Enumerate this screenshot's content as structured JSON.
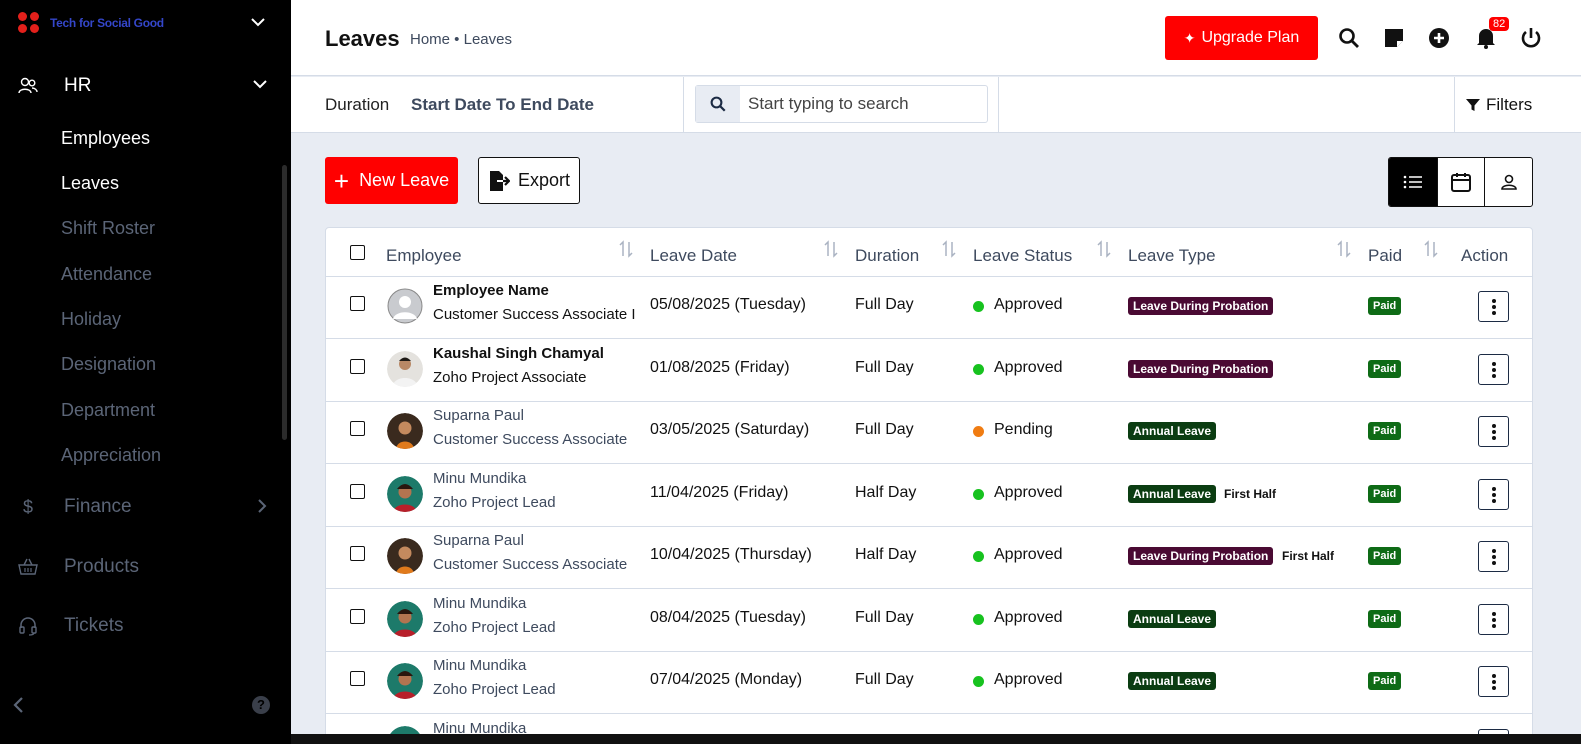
{
  "sidebar": {
    "brand": "Tech for Social Good",
    "hr_label": "HR",
    "hr_items": [
      "Employees",
      "Leaves",
      "Shift Roster",
      "Attendance",
      "Holiday",
      "Designation",
      "Department",
      "Appreciation"
    ],
    "finance_label": "Finance",
    "products_label": "Products",
    "tickets_label": "Tickets",
    "finance_icon": "$"
  },
  "header": {
    "title": "Leaves",
    "breadcrumb": "Home • Leaves",
    "upgrade_label": "Upgrade Plan",
    "notification_count": "82"
  },
  "filterbar": {
    "duration_label": "Duration",
    "duration_value": "Start Date To End Date",
    "search_placeholder": "Start typing to search",
    "filters_label": "Filters"
  },
  "actions": {
    "new_leave": "New Leave",
    "export": "Export"
  },
  "table": {
    "headers": {
      "employee": "Employee",
      "leave_date": "Leave Date",
      "duration": "Duration",
      "leave_status": "Leave Status",
      "leave_type": "Leave Type",
      "paid": "Paid",
      "action": "Action"
    },
    "rows": [
      {
        "name": "Employee Name",
        "role": "Customer Success Associate I",
        "date": "05/08/2025 (Tuesday)",
        "duration": "Full Day",
        "status": "Approved",
        "type": "Leave During Probation",
        "half": "",
        "paid": "Paid"
      },
      {
        "name": "Kaushal Singh Chamyal",
        "role": "Zoho Project Associate",
        "date": "01/08/2025 (Friday)",
        "duration": "Full Day",
        "status": "Approved",
        "type": "Leave During Probation",
        "half": "",
        "paid": "Paid"
      },
      {
        "name": "Suparna Paul",
        "role": "Customer Success Associate",
        "date": "03/05/2025 (Saturday)",
        "duration": "Full Day",
        "status": "Pending",
        "type": "Annual Leave",
        "half": "",
        "paid": "Paid"
      },
      {
        "name": "Minu Mundika",
        "role": "Zoho Project Lead",
        "date": "11/04/2025 (Friday)",
        "duration": "Half Day",
        "status": "Approved",
        "type": "Annual Leave",
        "half": "First Half",
        "paid": "Paid"
      },
      {
        "name": "Suparna Paul",
        "role": "Customer Success Associate",
        "date": "10/04/2025 (Thursday)",
        "duration": "Half Day",
        "status": "Approved",
        "type": "Leave During Probation",
        "half": "First Half",
        "paid": "Paid"
      },
      {
        "name": "Minu Mundika",
        "role": "Zoho Project Lead",
        "date": "08/04/2025 (Tuesday)",
        "duration": "Full Day",
        "status": "Approved",
        "type": "Annual Leave",
        "half": "",
        "paid": "Paid"
      },
      {
        "name": "Minu Mundika",
        "role": "Zoho Project Lead",
        "date": "07/04/2025 (Monday)",
        "duration": "Full Day",
        "status": "Approved",
        "type": "Annual Leave",
        "half": "",
        "paid": "Paid"
      },
      {
        "name": "Minu Mundika",
        "role": "",
        "date": "",
        "duration": "",
        "status": "",
        "type": "",
        "half": "",
        "paid": ""
      }
    ]
  },
  "colors": {
    "accent": "#ff0000",
    "approved": "#17c21f",
    "pending": "#f07c12",
    "probation_badge": "#4a0a33",
    "annual_badge": "#0b3d12",
    "paid_badge": "#0e6b16"
  }
}
